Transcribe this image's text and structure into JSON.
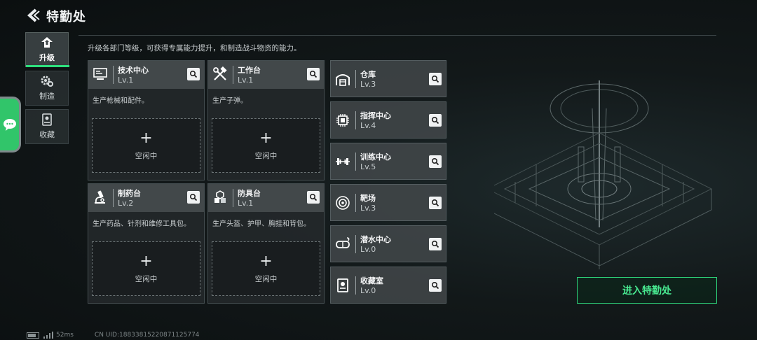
{
  "header": {
    "title": "特勤处"
  },
  "sidenav": [
    {
      "label": "升级",
      "icon": "upgrade-icon",
      "active": true
    },
    {
      "label": "制造",
      "icon": "manufacture-gear-icon",
      "active": false
    },
    {
      "label": "收藏",
      "icon": "collection-icon",
      "active": false
    }
  ],
  "subtitle": "升级各部门等级，可获得专属能力提升，和制造战斗物资的能力。",
  "large_cards": [
    {
      "name": "技术中心",
      "level": "Lv.1",
      "desc": "生产枪械和配件。",
      "slot_label": "空闲中",
      "icon": "tech-center-icon"
    },
    {
      "name": "工作台",
      "level": "Lv.1",
      "desc": "生产子弹。",
      "slot_label": "空闲中",
      "icon": "workbench-tools-icon"
    },
    {
      "name": "制药台",
      "level": "Lv.2",
      "desc": "生产药品、针剂和维修工具包。",
      "slot_label": "空闲中",
      "icon": "pharmacy-microscope-icon"
    },
    {
      "name": "防具台",
      "level": "Lv.1",
      "desc": "生产头盔、护甲、胸挂和背包。",
      "slot_label": "空闲中",
      "icon": "armor-bench-icon"
    }
  ],
  "small_cards": [
    {
      "name": "仓库",
      "level": "Lv.3",
      "icon": "warehouse-icon"
    },
    {
      "name": "指挥中心",
      "level": "Lv.4",
      "icon": "command-center-chip-icon"
    },
    {
      "name": "训练中心",
      "level": "Lv.5",
      "icon": "training-dumbbell-icon"
    },
    {
      "name": "靶场",
      "level": "Lv.3",
      "icon": "shooting-range-target-icon"
    },
    {
      "name": "潜水中心",
      "level": "Lv.0",
      "icon": "diving-goggles-icon"
    },
    {
      "name": "收藏室",
      "level": "Lv.0",
      "icon": "collection-room-icon"
    }
  ],
  "enter_button": "进入特勤处",
  "status": {
    "latency": "52ms",
    "uid": "CN UID:18833815220871125774"
  },
  "colors": {
    "accent": "#2ee07e",
    "background": "#121819",
    "card_header": "#4e5456"
  }
}
